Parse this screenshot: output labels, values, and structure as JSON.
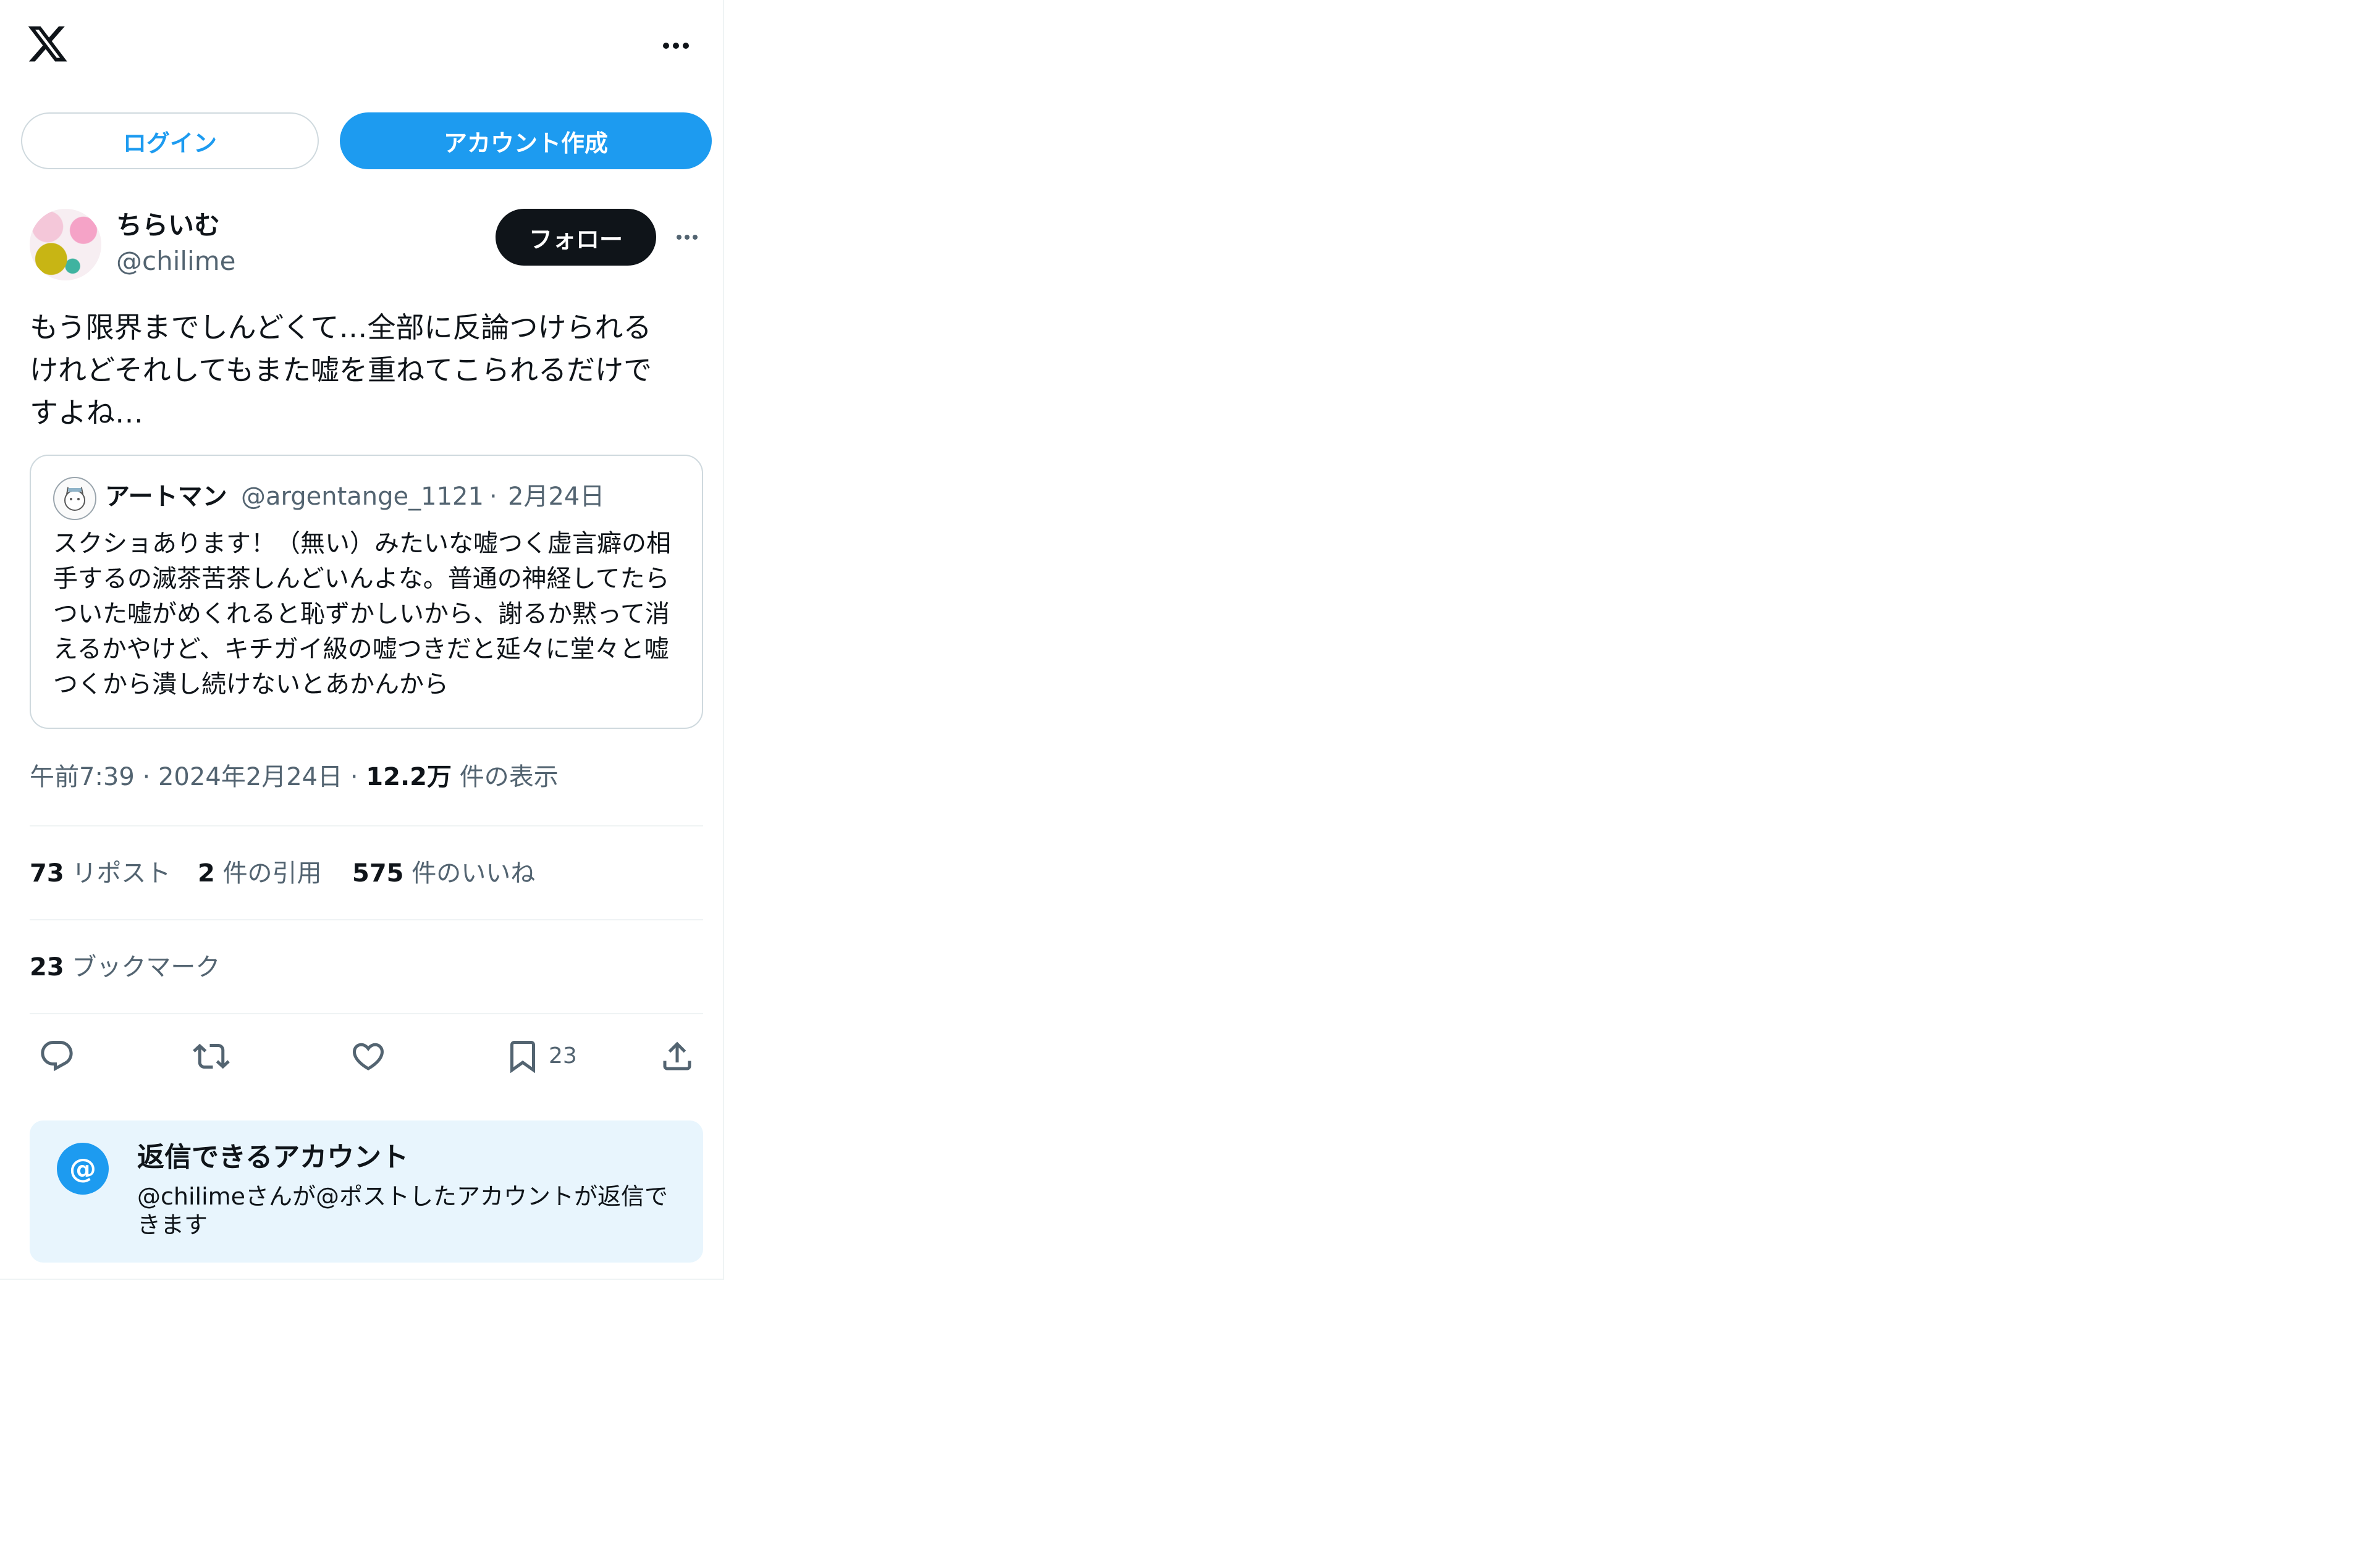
{
  "topbar": {
    "logo_icon": "x-logo-icon",
    "more_icon": "more-horizontal-icon"
  },
  "auth": {
    "login_label": "ログイン",
    "signup_label": "アカウント作成"
  },
  "post": {
    "author": {
      "name": "ちらいむ",
      "handle": "@chilime"
    },
    "follow_label": "フォロー",
    "text": "もう限界までしんどくて…全部に反論つけられる\nけれどそれしてもまた嘘を重ねてこられるだけで\nすよね…",
    "quoted": {
      "author_name": "アートマン",
      "author_handle": "@argentange_1121",
      "separator": "·",
      "date": "2月24日",
      "text": "スクショあります！（無い）みたいな嘘つく虚言癖の相手するの滅茶苦茶しんどいんよな。普通の神経してたらついた嘘がめくれると恥ずかしいから、謝るか黙って消えるかやけど、キチガイ級の嘘つきだと延々に堂々と嘘つくから潰し続けないとあかんから"
    },
    "meta": {
      "time_date": "午前7:39 · 2024年2月24日",
      "separator": "·",
      "views_count": "12.2万",
      "views_label": "件の表示"
    },
    "stats": {
      "reposts_count": "73",
      "reposts_label": "リポスト",
      "quotes_count": "2",
      "quotes_label": "件の引用",
      "likes_count": "575",
      "likes_label": "件のいいね",
      "bookmarks_count": "23",
      "bookmarks_label": "ブックマーク"
    },
    "actions": {
      "bookmark_count": "23"
    }
  },
  "reply_restriction": {
    "icon_glyph": "@",
    "title": "返信できるアカウント",
    "description": "@chilimeさんが@ポストしたアカウントが返信できます"
  },
  "colors": {
    "accent": "#1d9bf0",
    "text": "#0f1419",
    "muted": "#536471",
    "border": "#cfd9de",
    "info_bg": "#e8f5fd"
  }
}
